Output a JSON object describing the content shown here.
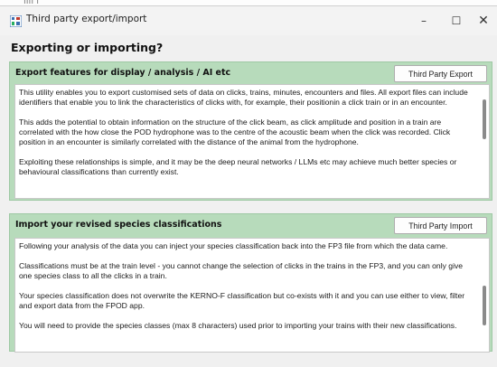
{
  "window": {
    "title": "Third party export/import",
    "controls": {
      "minimize": "–",
      "maximize": "☐",
      "close": "✕"
    }
  },
  "heading": "Exporting or importing?",
  "export_panel": {
    "title": "Export features for display / analysis  /  AI etc",
    "button_label": "Third Party Export",
    "paragraphs": [
      "This utility enables you to export customised sets of data on clicks, trains, minutes, encounters and files.  All export files can include identifiers that enable you to link the characteristics of clicks with, for example, their positionin a click train or in an encounter.",
      "This adds the potential to obtain information on the structure of the click beam, as click amplitude and position in a train are correlated with the how close the POD hydrophone was to the centre of the acoustic beam when the click was recorded.  Click position in an encounter is similarly correlated with the distance of the animal from the hydrophone.",
      "Exploiting these relationships is simple, and it may be the deep neural networks / LLMs etc may achieve much better species or behavioural classifications than currently exist."
    ]
  },
  "import_panel": {
    "title": "Import your revised species classifications",
    "button_label": "Third Party Import",
    "paragraphs": [
      "Following your analysis of the data you can inject your species classification back into the FP3 file from which the data came.",
      "Classifications must be at the train level - you cannot change the selection of clicks in the trains in the FP3, and you can only give one species class to all the clicks in a train.",
      "Your species classification does not overwrite the KERNO-F classification but co-exists with it and you can use either to view, filter and export data from the FPOD app.",
      "You will need to provide the species classes (max 8 characters) used prior to importing your trains with their new classifications."
    ]
  }
}
